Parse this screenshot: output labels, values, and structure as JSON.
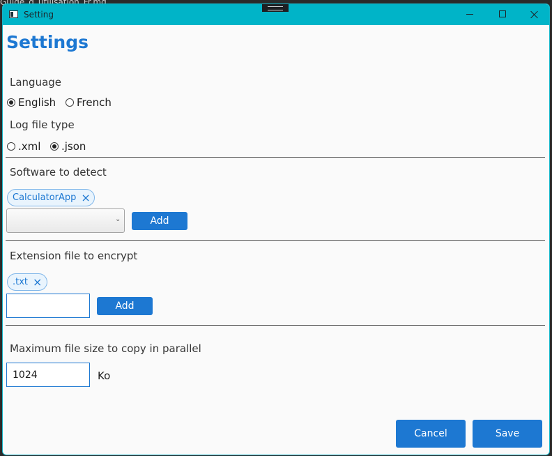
{
  "background": {
    "text": "Guide_d_utilisation_Fr.md"
  },
  "window": {
    "title": "Setting"
  },
  "settings": {
    "heading": "Settings",
    "language": {
      "label": "Language",
      "options": [
        {
          "label": "English",
          "selected": true
        },
        {
          "label": "French",
          "selected": false
        }
      ]
    },
    "log_file_type": {
      "label": "Log file type",
      "options": [
        {
          "label": ".xml",
          "selected": false
        },
        {
          "label": ".json",
          "selected": true
        }
      ]
    },
    "software": {
      "label": "Software to detect",
      "tags": [
        "CalculatorApp"
      ],
      "selected": "",
      "add_label": "Add"
    },
    "extension": {
      "label": "Extension file to encrypt",
      "tags": [
        ".txt"
      ],
      "value": "",
      "add_label": "Add"
    },
    "max_size": {
      "label": "Maximum file size to copy in parallel",
      "value": "1024",
      "unit": "Ko"
    },
    "actions": {
      "cancel": "Cancel",
      "save": "Save"
    }
  },
  "icons": {
    "close_tag": "×",
    "dropdown": "⌄"
  }
}
